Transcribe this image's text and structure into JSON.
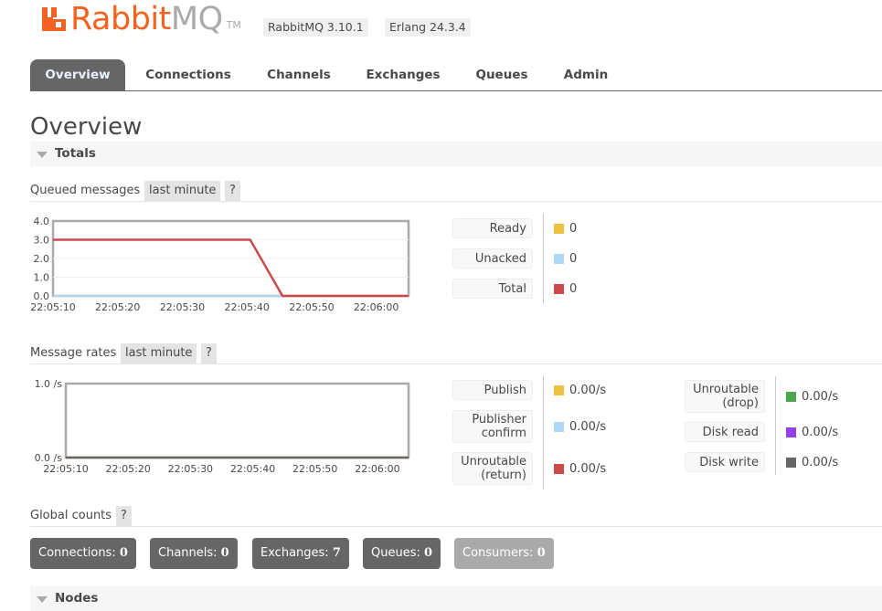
{
  "header": {
    "logo_text_primary": "Rabbit",
    "logo_text_secondary": "MQ",
    "logo_tm": "TM",
    "rabbitmq_version": "RabbitMQ 3.10.1",
    "erlang_version": "Erlang 24.3.4"
  },
  "tabs": [
    {
      "label": "Overview",
      "active": true
    },
    {
      "label": "Connections",
      "active": false
    },
    {
      "label": "Channels",
      "active": false
    },
    {
      "label": "Exchanges",
      "active": false
    },
    {
      "label": "Queues",
      "active": false
    },
    {
      "label": "Admin",
      "active": false
    }
  ],
  "page": {
    "title": "Overview",
    "totals_section": "Totals",
    "nodes_section": "Nodes"
  },
  "queued_messages": {
    "label": "Queued messages",
    "range": "last minute",
    "help": "?",
    "legend": [
      {
        "label": "Ready",
        "value": "0",
        "color": "#edc240"
      },
      {
        "label": "Unacked",
        "value": "0",
        "color": "#afd8f8"
      },
      {
        "label": "Total",
        "value": "0",
        "color": "#cb4b4b"
      }
    ]
  },
  "message_rates": {
    "label": "Message rates",
    "range": "last minute",
    "help": "?",
    "legend_left": [
      {
        "label_lines": [
          "Publish"
        ],
        "value": "0.00/s",
        "color": "#edc240"
      },
      {
        "label_lines": [
          "Publisher",
          "confirm"
        ],
        "value": "0.00/s",
        "color": "#afd8f8"
      },
      {
        "label_lines": [
          "Unroutable",
          "(return)"
        ],
        "value": "0.00/s",
        "color": "#cb4b4b"
      }
    ],
    "legend_right": [
      {
        "label_lines": [
          "Unroutable",
          "(drop)"
        ],
        "value": "0.00/s",
        "color": "#4da74d"
      },
      {
        "label_lines": [
          "Disk read"
        ],
        "value": "0.00/s",
        "color": "#9440ed"
      },
      {
        "label_lines": [
          "Disk write"
        ],
        "value": "0.00/s",
        "color": "#666666"
      }
    ]
  },
  "global_counts": {
    "label": "Global counts",
    "help": "?",
    "items": [
      {
        "label": "Connections:",
        "value": "0",
        "dim": false
      },
      {
        "label": "Channels:",
        "value": "0",
        "dim": false
      },
      {
        "label": "Exchanges:",
        "value": "7",
        "dim": false
      },
      {
        "label": "Queues:",
        "value": "0",
        "dim": false
      },
      {
        "label": "Consumers:",
        "value": "0",
        "dim": true
      }
    ]
  },
  "chart_data": [
    {
      "type": "line",
      "title": "Queued messages",
      "xlabel": "",
      "ylabel": "",
      "x_range_seconds": [
        0,
        55
      ],
      "x_ticks": [
        "22:05:10",
        "22:05:20",
        "22:05:30",
        "22:05:40",
        "22:05:50",
        "22:06:00"
      ],
      "y_ticks": [
        "0.0",
        "1.0",
        "2.0",
        "3.0",
        "4.0"
      ],
      "ylim": [
        0,
        4
      ],
      "grid": true,
      "series": [
        {
          "name": "Ready",
          "color": "#edc240",
          "x": [
            0,
            55
          ],
          "y": [
            0,
            0
          ]
        },
        {
          "name": "Unacked",
          "color": "#afd8f8",
          "x": [
            0,
            35,
            55
          ],
          "y": [
            0,
            0,
            0
          ]
        },
        {
          "name": "Total",
          "color": "#cb4b4b",
          "x": [
            0,
            30.5,
            35.5,
            55
          ],
          "y": [
            3,
            3,
            0,
            0
          ]
        }
      ]
    },
    {
      "type": "line",
      "title": "Message rates",
      "xlabel": "",
      "ylabel": "",
      "x_range_seconds": [
        0,
        55
      ],
      "x_ticks": [
        "22:05:10",
        "22:05:20",
        "22:05:30",
        "22:05:40",
        "22:05:50",
        "22:06:00"
      ],
      "y_ticks": [
        "0.0 /s",
        "1.0 /s"
      ],
      "ylim": [
        0,
        1
      ],
      "grid": false,
      "series": [
        {
          "name": "Publish",
          "color": "#edc240",
          "x": [
            0,
            55
          ],
          "y": [
            0,
            0
          ]
        },
        {
          "name": "Disk write",
          "color": "#666666",
          "x": [
            0,
            55
          ],
          "y": [
            0,
            0
          ]
        }
      ]
    }
  ]
}
